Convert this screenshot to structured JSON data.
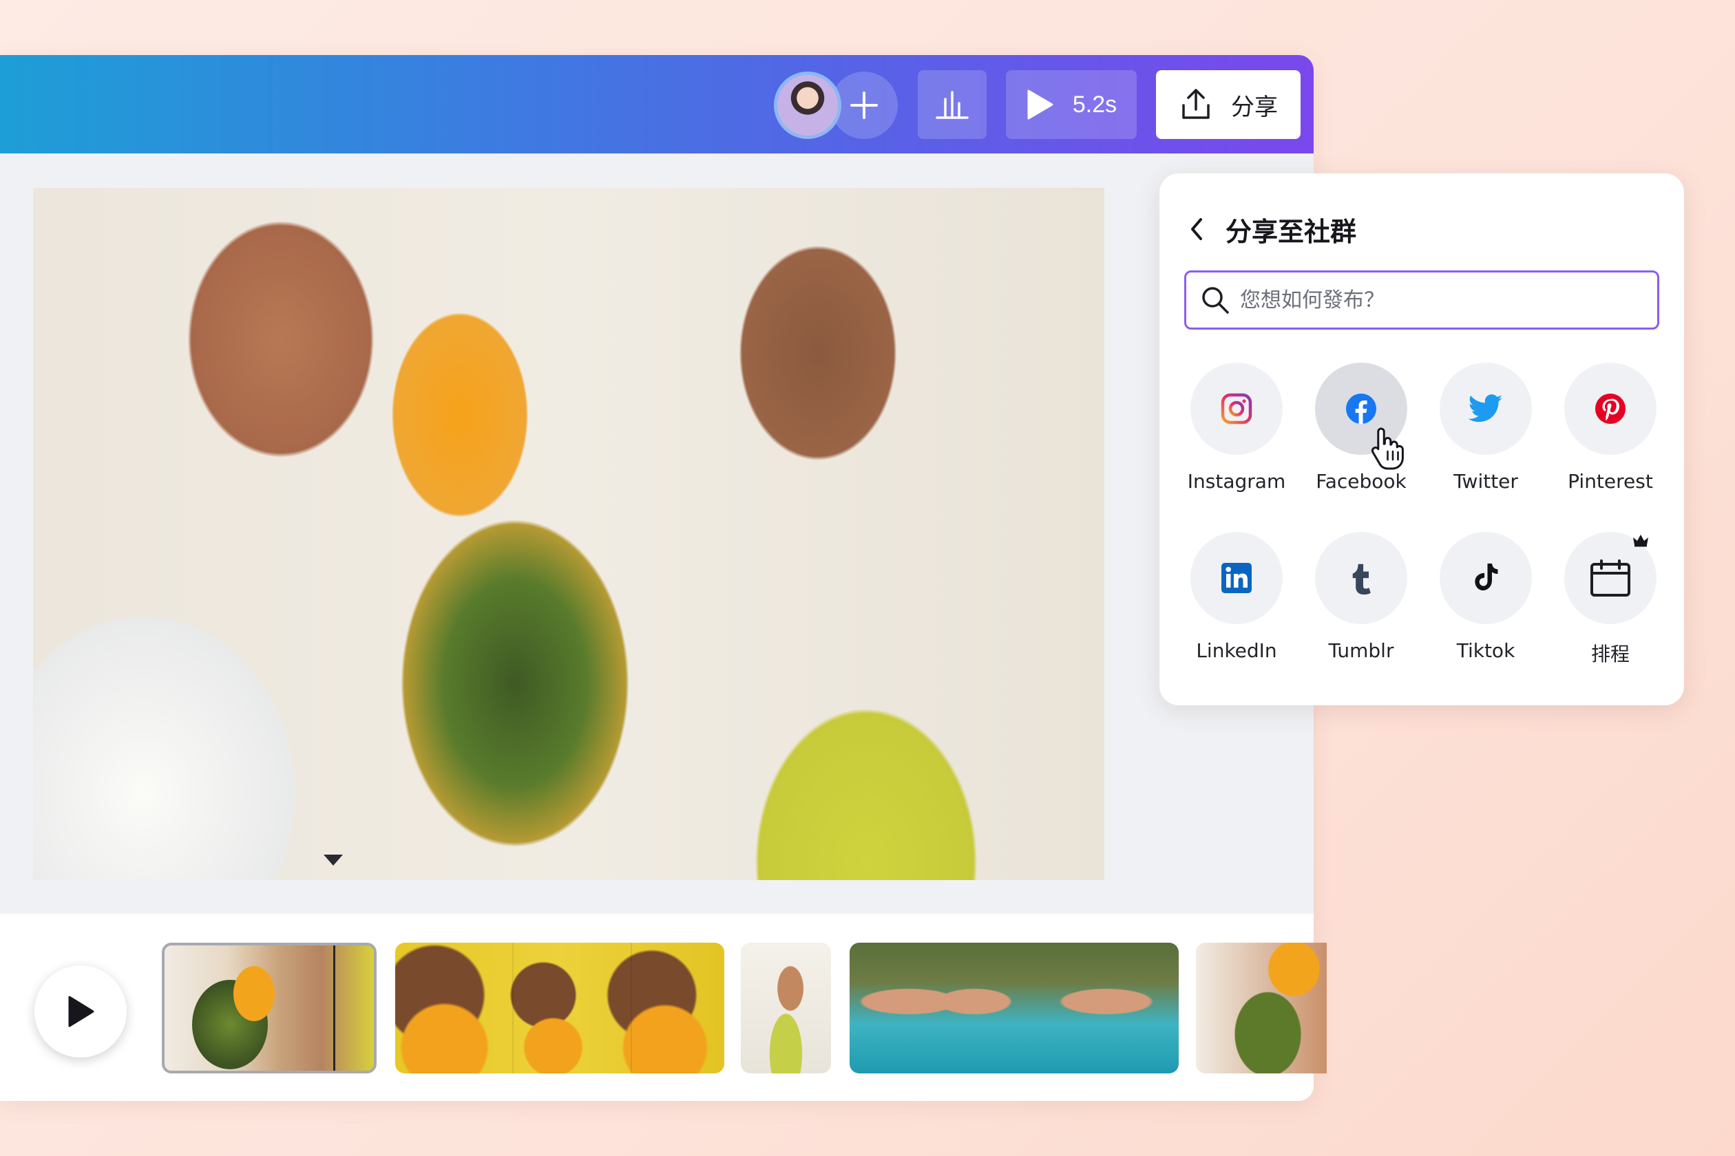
{
  "toolbar": {
    "play_duration": "5.2s",
    "share_label": "分享"
  },
  "share_panel": {
    "title": "分享至社群",
    "search_placeholder": "您想如何發布？",
    "options": [
      {
        "label": "Instagram",
        "icon": "instagram-icon"
      },
      {
        "label": "Facebook",
        "icon": "facebook-icon",
        "hovered": true
      },
      {
        "label": "Twitter",
        "icon": "twitter-icon"
      },
      {
        "label": "Pinterest",
        "icon": "pinterest-icon"
      },
      {
        "label": "LinkedIn",
        "icon": "linkedin-icon"
      },
      {
        "label": "Tumblr",
        "icon": "tumblr-icon"
      },
      {
        "label": "Tiktok",
        "icon": "tiktok-icon"
      },
      {
        "label": "排程",
        "icon": "calendar-icon",
        "premium": true
      }
    ]
  },
  "colors": {
    "topbar_start": "#1e9ed6",
    "topbar_end": "#7a48ec",
    "search_border": "#8b5ef0",
    "instagram": "#e1306c",
    "facebook": "#1877f2",
    "twitter": "#1d9bf0",
    "pinterest": "#e60023",
    "linkedin": "#0a66c2",
    "tumblr": "#36465d"
  }
}
